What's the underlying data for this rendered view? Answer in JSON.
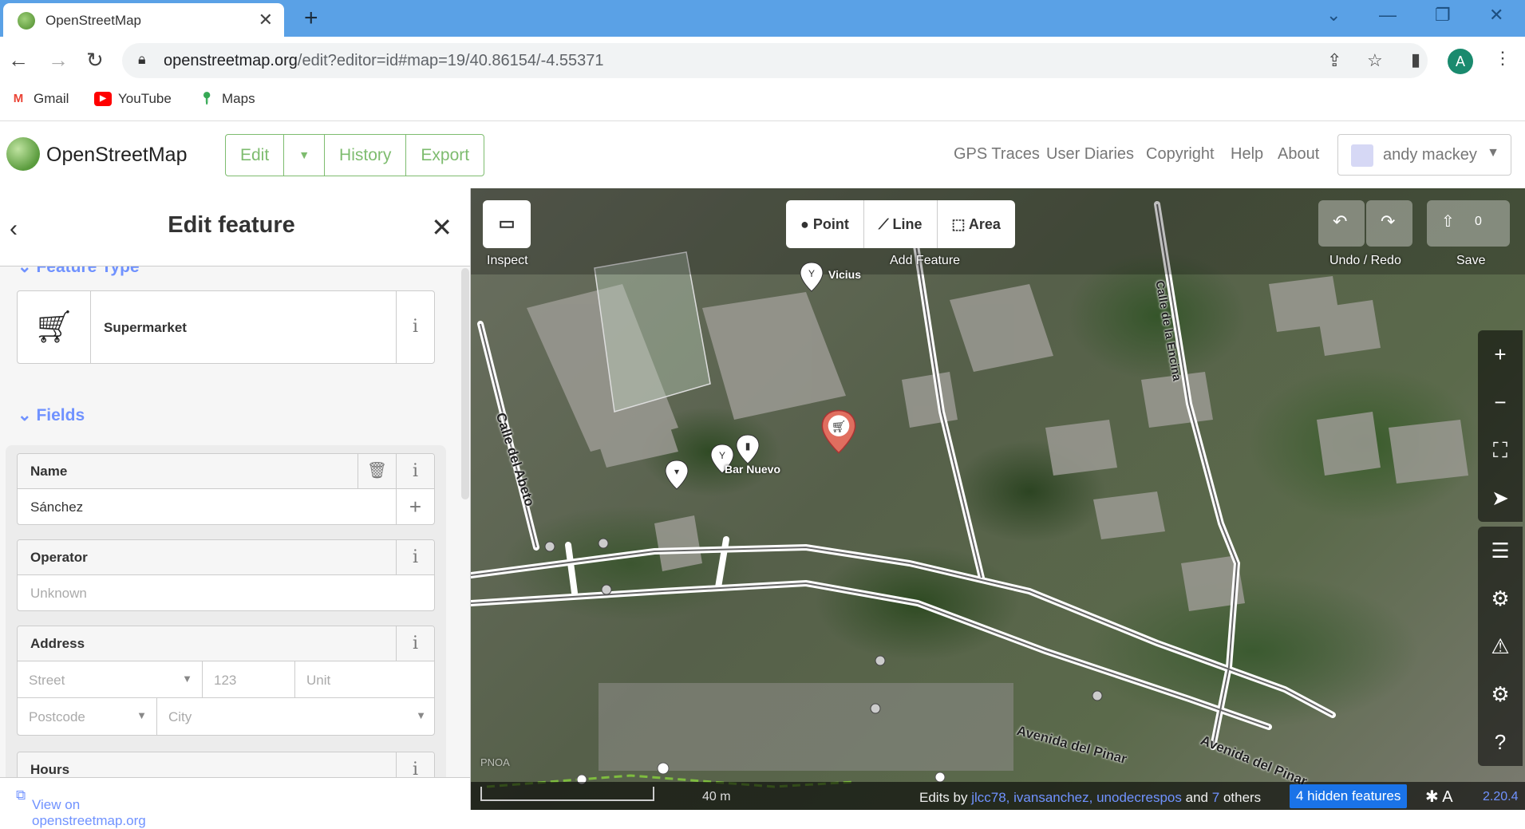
{
  "browser": {
    "tab_title": "OpenStreetMap",
    "tab_close": "✕",
    "new_tab": "+",
    "url_host": "openstreetmap.org",
    "url_path": "/edit?editor=id#map=19/40.86154/-4.55371",
    "profile_initial": "A",
    "bookmarks": [
      {
        "label": "Gmail",
        "icon": "gmail-icon",
        "glyph": "M",
        "color": "#ea4335"
      },
      {
        "label": "YouTube",
        "icon": "youtube-icon",
        "glyph": "▶",
        "color": "#ff0000"
      },
      {
        "label": "Maps",
        "icon": "maps-icon",
        "glyph": "⬤",
        "color": "#34a853"
      }
    ]
  },
  "osm_header": {
    "site_name": "OpenStreetMap",
    "edit_label": "Edit",
    "history_label": "History",
    "export_label": "Export",
    "nav_links": [
      "GPS Traces",
      "User Diaries",
      "Copyright",
      "Help",
      "About"
    ],
    "username": "andy mackey"
  },
  "sidebar": {
    "title": "Edit feature",
    "feature_type_header": "Feature Type",
    "preset_name": "Supermarket",
    "fields_header": "Fields",
    "fields": {
      "name": {
        "label": "Name",
        "value": "Sánchez"
      },
      "operator": {
        "label": "Operator",
        "placeholder": "Unknown"
      },
      "address": {
        "label": "Address",
        "street_placeholder": "Street",
        "housenumber_placeholder": "123",
        "unit_placeholder": "Unit",
        "postcode_placeholder": "Postcode",
        "city_placeholder": "City"
      },
      "hours": {
        "label": "Hours"
      }
    },
    "view_on_link": "View on openstreetmap.org"
  },
  "map": {
    "inspect_label": "Inspect",
    "tools": {
      "point": "Point",
      "line": "Line",
      "area": "Area",
      "group_label": "Add Feature"
    },
    "undo_redo_label": "Undo / Redo",
    "save_label": "Save",
    "save_count": "0",
    "poi_labels": {
      "vicius": "Vicius",
      "bar_nuevo": "Bar Nuevo"
    },
    "road_labels": {
      "calle_abeto": "Calle del Abeto",
      "calle_encina": "Calle de la Encina",
      "avenida_pinar_1": "Avenida del Pinar",
      "avenida_pinar_2": "Avenida del Pinar"
    },
    "imagery_badge": "PNOA",
    "footer": {
      "scale_label": "40 m",
      "edits_by": "Edits by",
      "editors": "jlcc78, ivansanchez, unodecrespos",
      "and_text": "and",
      "others_count": "7",
      "others_text": "others",
      "hidden_features": "4 hidden features",
      "version": "2.20.4"
    }
  }
}
